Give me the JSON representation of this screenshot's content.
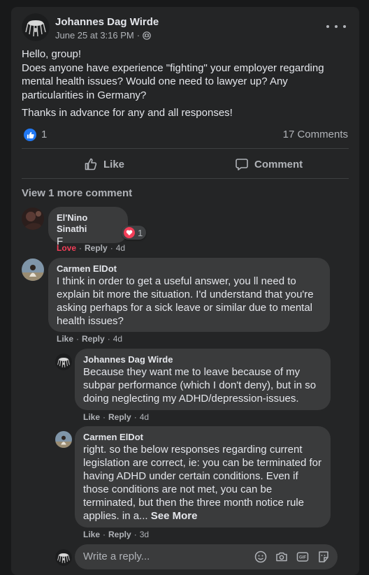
{
  "post": {
    "author": "Johannes Dag Wirde",
    "date": "June 25 at 3:16 PM",
    "separator": "·",
    "body": [
      "Hello, group!",
      "Does anyone have experience \"fighting\" your employer regarding mental health issues? Would one need to lawyer up? Any particularities in Germany?",
      "Thanks in advance for any and all responses!"
    ],
    "reactions_count": "1",
    "comments_count": "17 Comments"
  },
  "actions": {
    "like": "Like",
    "comment": "Comment"
  },
  "view_more": "View 1 more comment",
  "comments": [
    {
      "author": "El'Nino Sinathi",
      "text": "F",
      "reaction_count": "1",
      "reaction_label": "Love",
      "reply": "Reply",
      "time": "4d"
    },
    {
      "author": "Carmen ElDot",
      "text": "I think in order to get a useful answer, you ll need to explain bit more the situation. I'd understand that you're asking perhaps for a sick leave or similar due to mental health issues?",
      "like": "Like",
      "reply": "Reply",
      "time": "4d"
    }
  ],
  "replies": [
    {
      "author": "Johannes Dag Wirde",
      "text": "Because they want me to leave because of my subpar performance (which I don't deny), but in so doing neglecting my ADHD/depression-issues.",
      "like": "Like",
      "reply": "Reply",
      "time": "4d"
    },
    {
      "author": "Carmen ElDot",
      "text": "right. so the below responses regarding current legislation are correct, ie: you can be terminated for having ADHD under certain conditions. Even if those conditions are not met, you can be terminated, but then the three month notice rule applies. in a...",
      "see_more": "See More",
      "like": "Like",
      "reply": "Reply",
      "time": "3d"
    }
  ],
  "reply_box": {
    "placeholder": "Write a reply..."
  },
  "icons": [
    "more-options-icon",
    "globe-icon",
    "like-reaction-icon",
    "thumbs-up-icon",
    "comment-icon",
    "love-reaction-icon",
    "emoji-icon",
    "camera-icon",
    "gif-icon",
    "sticker-icon"
  ],
  "colors": {
    "background": "#18191a",
    "card": "#242526",
    "bubble": "#3a3b3c",
    "like_blue": "#2078f4",
    "love_red": "#f33e58",
    "text": "#e4e6eb",
    "secondary": "#b0b3b8"
  }
}
